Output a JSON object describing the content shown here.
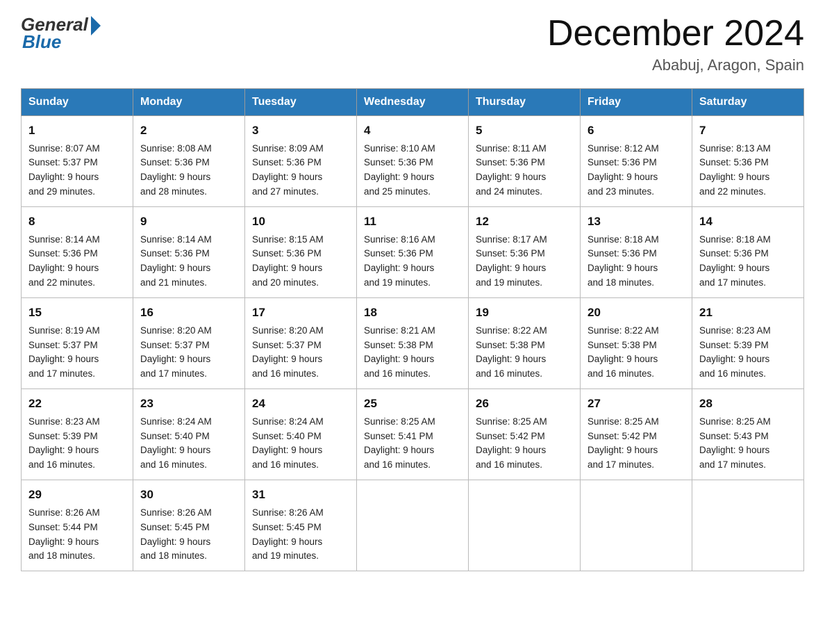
{
  "logo": {
    "general": "General",
    "blue": "Blue"
  },
  "title": "December 2024",
  "subtitle": "Ababuj, Aragon, Spain",
  "weekdays": [
    "Sunday",
    "Monday",
    "Tuesday",
    "Wednesday",
    "Thursday",
    "Friday",
    "Saturday"
  ],
  "weeks": [
    [
      {
        "day": "1",
        "sunrise": "8:07 AM",
        "sunset": "5:37 PM",
        "daylight": "9 hours and 29 minutes."
      },
      {
        "day": "2",
        "sunrise": "8:08 AM",
        "sunset": "5:36 PM",
        "daylight": "9 hours and 28 minutes."
      },
      {
        "day": "3",
        "sunrise": "8:09 AM",
        "sunset": "5:36 PM",
        "daylight": "9 hours and 27 minutes."
      },
      {
        "day": "4",
        "sunrise": "8:10 AM",
        "sunset": "5:36 PM",
        "daylight": "9 hours and 25 minutes."
      },
      {
        "day": "5",
        "sunrise": "8:11 AM",
        "sunset": "5:36 PM",
        "daylight": "9 hours and 24 minutes."
      },
      {
        "day": "6",
        "sunrise": "8:12 AM",
        "sunset": "5:36 PM",
        "daylight": "9 hours and 23 minutes."
      },
      {
        "day": "7",
        "sunrise": "8:13 AM",
        "sunset": "5:36 PM",
        "daylight": "9 hours and 22 minutes."
      }
    ],
    [
      {
        "day": "8",
        "sunrise": "8:14 AM",
        "sunset": "5:36 PM",
        "daylight": "9 hours and 22 minutes."
      },
      {
        "day": "9",
        "sunrise": "8:14 AM",
        "sunset": "5:36 PM",
        "daylight": "9 hours and 21 minutes."
      },
      {
        "day": "10",
        "sunrise": "8:15 AM",
        "sunset": "5:36 PM",
        "daylight": "9 hours and 20 minutes."
      },
      {
        "day": "11",
        "sunrise": "8:16 AM",
        "sunset": "5:36 PM",
        "daylight": "9 hours and 19 minutes."
      },
      {
        "day": "12",
        "sunrise": "8:17 AM",
        "sunset": "5:36 PM",
        "daylight": "9 hours and 19 minutes."
      },
      {
        "day": "13",
        "sunrise": "8:18 AM",
        "sunset": "5:36 PM",
        "daylight": "9 hours and 18 minutes."
      },
      {
        "day": "14",
        "sunrise": "8:18 AM",
        "sunset": "5:36 PM",
        "daylight": "9 hours and 17 minutes."
      }
    ],
    [
      {
        "day": "15",
        "sunrise": "8:19 AM",
        "sunset": "5:37 PM",
        "daylight": "9 hours and 17 minutes."
      },
      {
        "day": "16",
        "sunrise": "8:20 AM",
        "sunset": "5:37 PM",
        "daylight": "9 hours and 17 minutes."
      },
      {
        "day": "17",
        "sunrise": "8:20 AM",
        "sunset": "5:37 PM",
        "daylight": "9 hours and 16 minutes."
      },
      {
        "day": "18",
        "sunrise": "8:21 AM",
        "sunset": "5:38 PM",
        "daylight": "9 hours and 16 minutes."
      },
      {
        "day": "19",
        "sunrise": "8:22 AM",
        "sunset": "5:38 PM",
        "daylight": "9 hours and 16 minutes."
      },
      {
        "day": "20",
        "sunrise": "8:22 AM",
        "sunset": "5:38 PM",
        "daylight": "9 hours and 16 minutes."
      },
      {
        "day": "21",
        "sunrise": "8:23 AM",
        "sunset": "5:39 PM",
        "daylight": "9 hours and 16 minutes."
      }
    ],
    [
      {
        "day": "22",
        "sunrise": "8:23 AM",
        "sunset": "5:39 PM",
        "daylight": "9 hours and 16 minutes."
      },
      {
        "day": "23",
        "sunrise": "8:24 AM",
        "sunset": "5:40 PM",
        "daylight": "9 hours and 16 minutes."
      },
      {
        "day": "24",
        "sunrise": "8:24 AM",
        "sunset": "5:40 PM",
        "daylight": "9 hours and 16 minutes."
      },
      {
        "day": "25",
        "sunrise": "8:25 AM",
        "sunset": "5:41 PM",
        "daylight": "9 hours and 16 minutes."
      },
      {
        "day": "26",
        "sunrise": "8:25 AM",
        "sunset": "5:42 PM",
        "daylight": "9 hours and 16 minutes."
      },
      {
        "day": "27",
        "sunrise": "8:25 AM",
        "sunset": "5:42 PM",
        "daylight": "9 hours and 17 minutes."
      },
      {
        "day": "28",
        "sunrise": "8:25 AM",
        "sunset": "5:43 PM",
        "daylight": "9 hours and 17 minutes."
      }
    ],
    [
      {
        "day": "29",
        "sunrise": "8:26 AM",
        "sunset": "5:44 PM",
        "daylight": "9 hours and 18 minutes."
      },
      {
        "day": "30",
        "sunrise": "8:26 AM",
        "sunset": "5:45 PM",
        "daylight": "9 hours and 18 minutes."
      },
      {
        "day": "31",
        "sunrise": "8:26 AM",
        "sunset": "5:45 PM",
        "daylight": "9 hours and 19 minutes."
      },
      null,
      null,
      null,
      null
    ]
  ],
  "labels": {
    "sunrise": "Sunrise:",
    "sunset": "Sunset:",
    "daylight": "Daylight:"
  }
}
